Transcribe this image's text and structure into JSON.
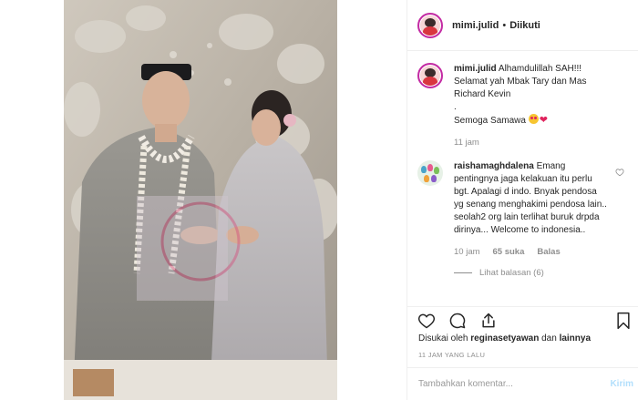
{
  "header": {
    "username": "mimi.julid",
    "separator": "•",
    "follow_status": "Diikuti"
  },
  "caption": {
    "username": "mimi.julid",
    "lines": [
      "Alhamdulillah SAH!!!",
      "Selamat yah Mbak Tary dan Mas",
      "Richard Kevin",
      ".",
      "Semoga Samawa"
    ],
    "time": "11 jam"
  },
  "comment": {
    "username": "raishamaghdalena",
    "text": "Emang pentingnya jaga kelakuan itu perlu bgt. Apalagi d indo. Bnyak pendosa yg senang menghakimi pendosa lain.. seolah2 org lain terlihat buruk drpda dirinya... Welcome to indonesia..",
    "time": "10 jam",
    "likes": "65 suka",
    "reply_label": "Balas",
    "view_replies": "Lihat balasan (6)"
  },
  "actions": {
    "liked_by_prefix": "Disukai oleh",
    "liked_by_user": "reginasetyawan",
    "liked_by_joiner": "dan",
    "liked_by_others": "lainnya",
    "timestamp": "11 JAM YANG LALU"
  },
  "add_comment": {
    "placeholder": "Tambahkan komentar...",
    "post_label": "Kirim"
  },
  "colors": {
    "story_ring": "#c32aa3",
    "post_button_disabled": "#b2dffc",
    "secondary_text": "#8e8e8e"
  }
}
